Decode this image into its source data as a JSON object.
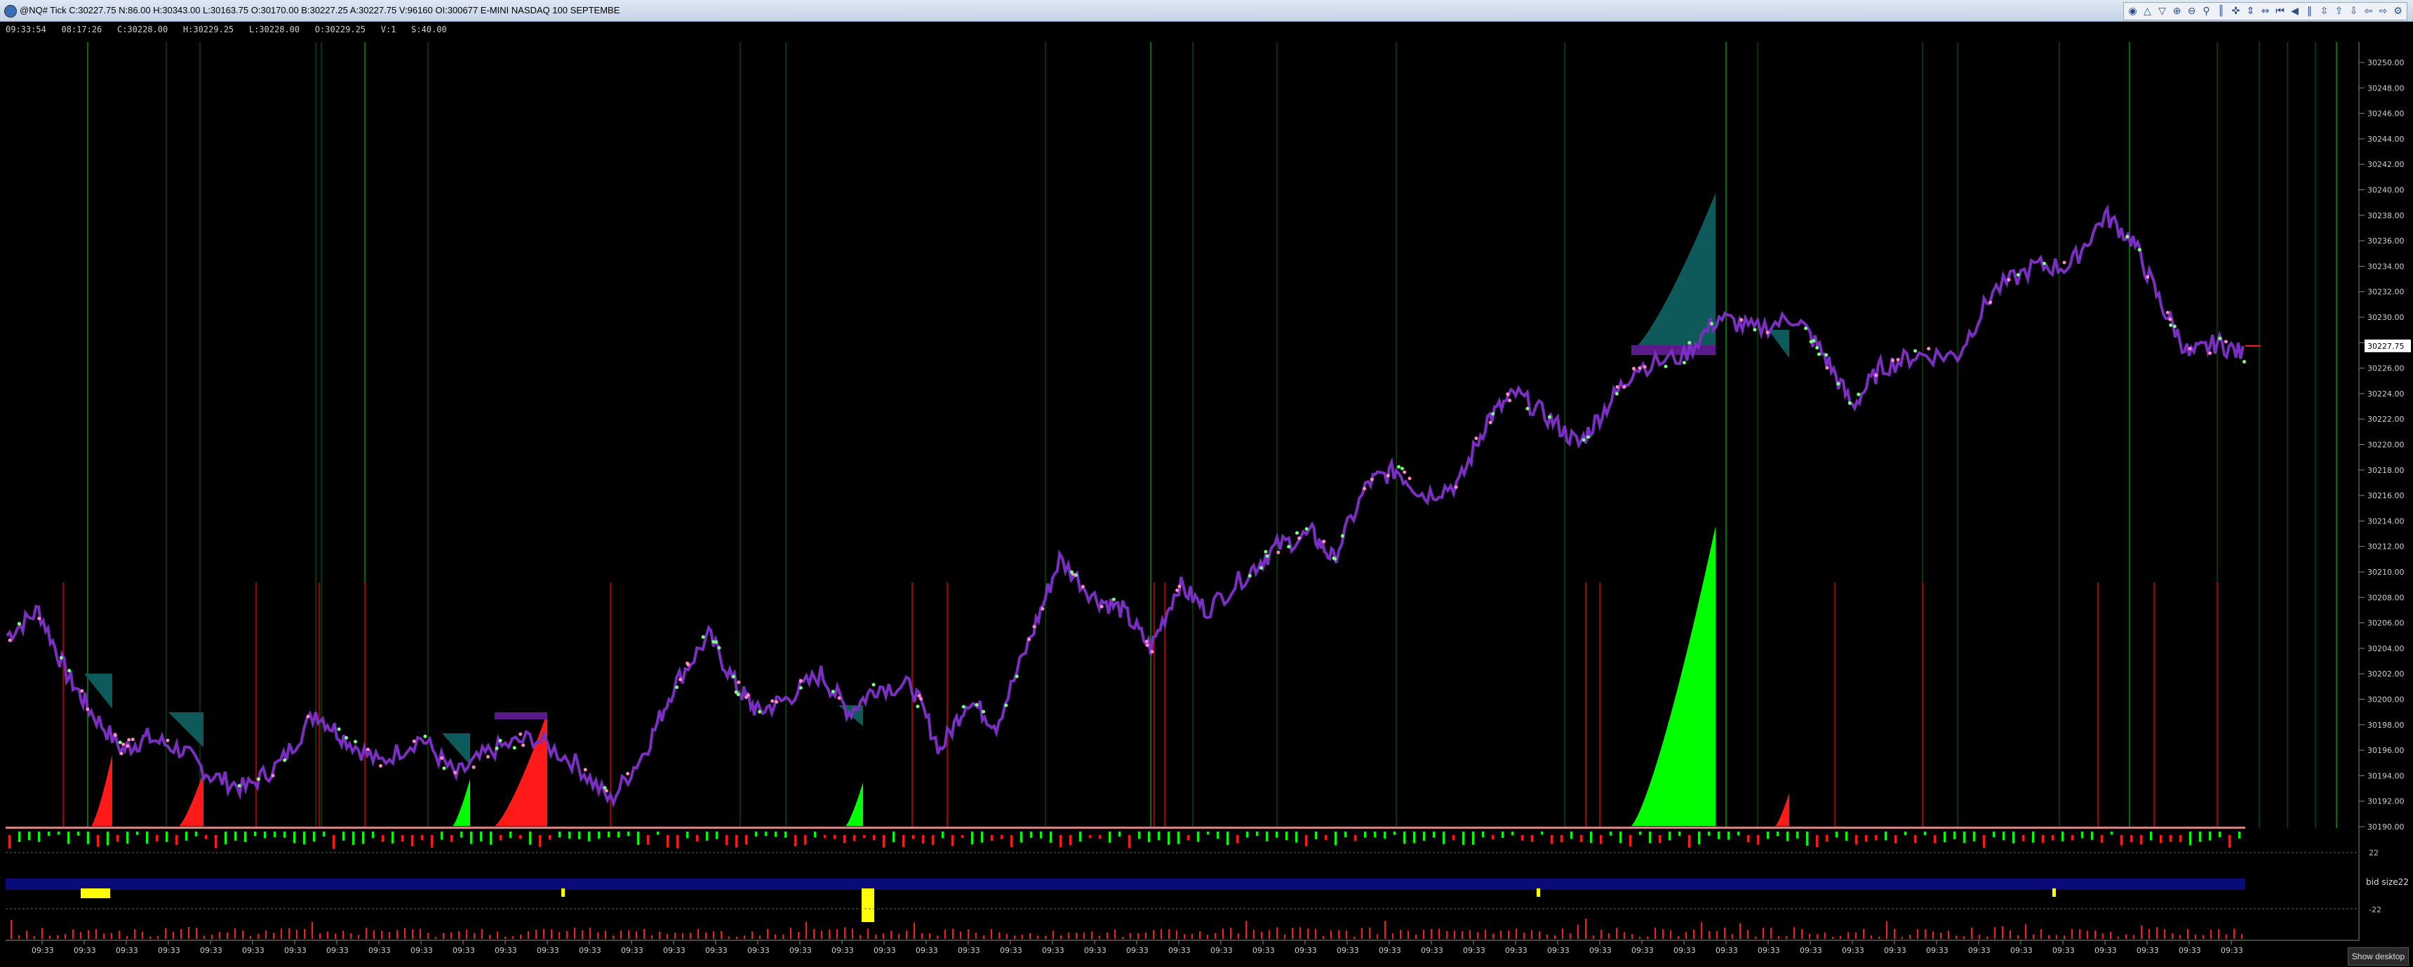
{
  "window": {
    "title": "@NQ# Tick C:30227.75 N:86.00 H:30343.00 L:30163.75 O:30170.00 B:30227.25 A:30227.75 V:96160 OI:300677 E-MINI NASDAQ 100 SEPTEMBE"
  },
  "toolbar": {
    "icons": [
      "color-wheel-icon",
      "triangle-icon",
      "draw-tool-icon",
      "zoom-in-icon",
      "zoom-out-icon",
      "chart-type-icon",
      "bars-icon",
      "crosshair-icon",
      "scale-icon",
      "align-icon",
      "rewind-icon",
      "play-back-icon",
      "pause-icon",
      "expand-icon",
      "arrow-up-icon",
      "arrow-down-icon",
      "arrow-left-icon",
      "arrow-right-icon",
      "settings-icon"
    ],
    "glyphs": [
      "◉",
      "△",
      "▽",
      "⊕",
      "⊖",
      "⚲",
      "║",
      "✜",
      "⇕",
      "⇔",
      "⏮",
      "◀",
      "‖",
      "⇳",
      "⇧",
      "⇩",
      "⇦",
      "⇨",
      "⚙"
    ]
  },
  "info": {
    "time": "09:33:54",
    "duration": "08:17:26",
    "close": "C:30228.00",
    "high": "H:30229.25",
    "low": "L:30228.00",
    "open": "O:30229.25",
    "volume": "V:1",
    "size": "S:40.00"
  },
  "price_axis": {
    "labels": [
      "30250.00",
      "30248.00",
      "30246.00",
      "30244.00",
      "30242.00",
      "30240.00",
      "30238.00",
      "30236.00",
      "30234.00",
      "30232.00",
      "30230.00",
      "30228.00",
      "30226.00",
      "30224.00",
      "30222.00",
      "30220.00",
      "30218.00",
      "30216.00",
      "30214.00",
      "30212.00",
      "30210.00",
      "30208.00",
      "30206.00",
      "30204.00",
      "30202.00",
      "30200.00",
      "30198.00",
      "30196.00",
      "30194.00",
      "30192.00",
      "30190.00"
    ],
    "current_price": "30227.75"
  },
  "time_axis": {
    "labels": [
      "09:33",
      "09:33",
      "09:33",
      "09:33",
      "09:33",
      "09:33",
      "09:33",
      "09:33",
      "09:33",
      "09:33",
      "09:33",
      "09:33",
      "09:33",
      "09:33",
      "09:33",
      "09:33",
      "09:33",
      "09:33",
      "09:33",
      "09:33",
      "09:33",
      "09:33",
      "09:33",
      "09:33",
      "09:33",
      "09:33",
      "09:33",
      "09:33",
      "09:33",
      "09:33",
      "09:33",
      "09:33",
      "09:33",
      "09:33",
      "09:33",
      "09:33",
      "09:33",
      "09:33",
      "09:33",
      "09:33",
      "09:33",
      "09:33",
      "09:33",
      "09:33",
      "09:33",
      "09:33",
      "09:33",
      "09:33",
      "09:33",
      "09:33",
      "09:33",
      "09:33",
      "09:33"
    ]
  },
  "subpanels": {
    "upper_value": "22",
    "lower_value": "-22",
    "bid_size_label": "bid size",
    "bid_size_value": "22"
  },
  "taskbar": {
    "show_desktop": "Show desktop"
  },
  "colors": {
    "background": "#000000",
    "price_line": "#7a2fc2",
    "up_volume": "#00ff00",
    "down_volume": "#ff1a1a",
    "teal_profile": "#0e5a5a",
    "vertical_green": "#0a6a0a",
    "vertical_red": "#a00000",
    "bid_band": "#0a0a7a",
    "bid_bar": "#ffff00"
  }
}
